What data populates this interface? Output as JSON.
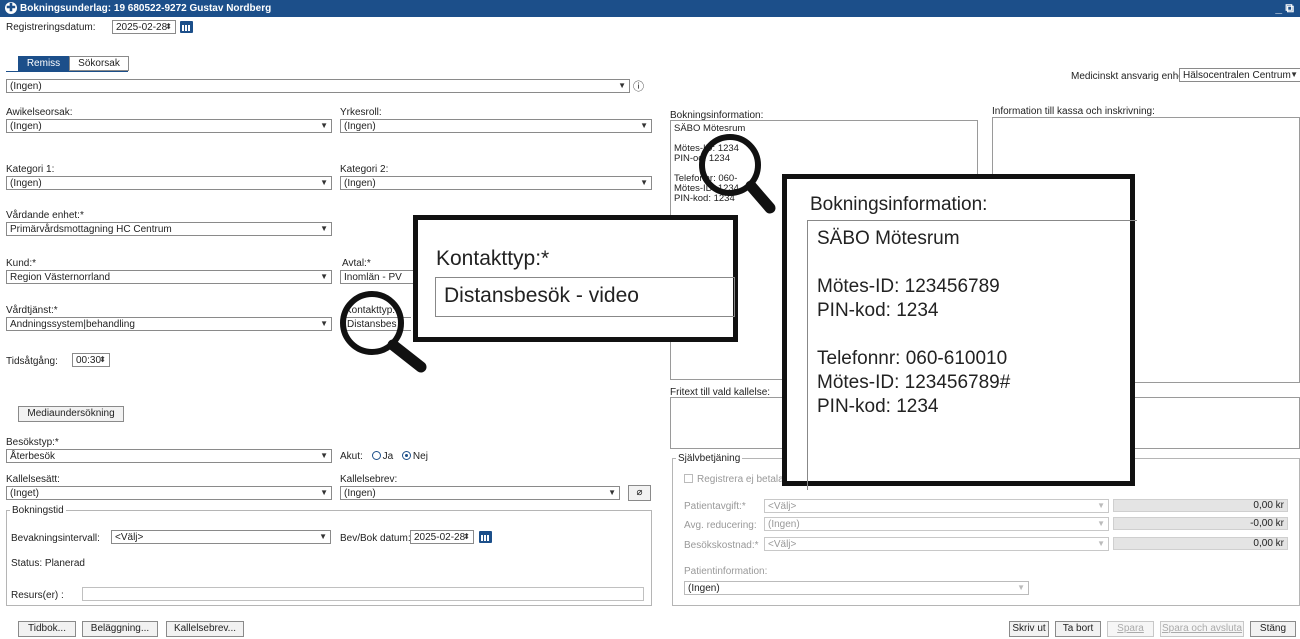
{
  "window": {
    "title": "Bokningsunderlag: 19 680522-9272 Gustav Nordberg",
    "controls": "_ ⧉"
  },
  "registrering": {
    "label": "Registreringsdatum:",
    "value": "2025-02-28"
  },
  "tabs": [
    {
      "label": "Remiss"
    },
    {
      "label": "Sökorsak"
    }
  ],
  "remiss_select": "(Ingen)",
  "medicinskt": {
    "label": "Medicinskt ansvarig enhet*:",
    "value": "Hälsocentralen Centrum"
  },
  "avvikelseorsak": {
    "label": "Awikelseorsak:",
    "value": "(Ingen)"
  },
  "yrkesroll": {
    "label": "Yrkesroll:",
    "value": "(Ingen)"
  },
  "kategori1": {
    "label": "Kategori 1:",
    "value": "(Ingen)"
  },
  "kategori2": {
    "label": "Kategori 2:",
    "value": "(Ingen)"
  },
  "vardande": {
    "label": "Vårdande enhet:*",
    "value": "Primärvårdsmottagning HC Centrum"
  },
  "kund": {
    "label": "Kund:*",
    "value": "Region Västernorrland"
  },
  "avtal": {
    "label": "Avtal:*",
    "value": "Inomlän - PV"
  },
  "vardtjanst": {
    "label": "Vårdtjänst:*",
    "value": "Andningssystem|behandling"
  },
  "kontakttyp": {
    "label": "Kontakttyp:*",
    "value": "Distansbesök - video",
    "small_value": "Distansbes"
  },
  "tidsatgang": {
    "label": "Tidsåtgång:",
    "value": "00:30"
  },
  "mediaundersokning": "Mediaundersökning",
  "besokstyp": {
    "label": "Besökstyp:*",
    "value": "Återbesök"
  },
  "akut": {
    "label": "Akut:",
    "ja": "Ja",
    "nej": "Nej"
  },
  "kallelsesatt": {
    "label": "Kallelsesätt:",
    "value": "(Inget)"
  },
  "kallelsebrev": {
    "label": "Kallelsebrev:",
    "value": "(Ingen)"
  },
  "bokningstid": {
    "legend": "Bokningstid",
    "bevakning_label": "Bevakningsintervall:",
    "bevakning_value": "<Välj>",
    "bevbok_label": "Bev/Bok datum:*",
    "bevbok_value": "2025-02-28",
    "status": "Status: Planerad",
    "resurs_label": "Resurs(er) :"
  },
  "bokningsinformation": {
    "label": "Bokningsinformation:",
    "lines": [
      "SÄBO Mötesrum",
      "",
      "Mötes-ID: 123456789",
      "PIN-kod: 1234",
      "",
      "Telefonnr: 060-610010",
      "Mötes-ID: 123456789#",
      "PIN-kod: 1234"
    ],
    "small_lines": [
      "SÄBO Mötesrum",
      "",
      "Möte",
      "PIN-",
      "",
      "Tele",
      "Möte",
      "PIN-kod: 1234"
    ]
  },
  "small_partial": [
    "s-ID: 1234",
    "od: 1234",
    "fonnr: 060-",
    "s-ID: 1234"
  ],
  "info_kassa": {
    "label": "Information till kassa och inskrivning:"
  },
  "fritext": {
    "label": "Fritext till vald kallelse:"
  },
  "sjalvbetjaning": {
    "legend": "Självbetjäning",
    "registrera": "Registrera ej betala",
    "patientavgift": {
      "label": "Patientavgift:*",
      "value": "<Välj>",
      "amount": "0,00 kr"
    },
    "avg_reducering": {
      "label": "Avg. reducering:",
      "value": "(Ingen)",
      "amount": "-0,00 kr"
    },
    "besokskostnad": {
      "label": "Besökskostnad:*",
      "value": "<Välj>",
      "amount": "0,00 kr"
    },
    "patientinformation": {
      "label": "Patientinformation:",
      "value": "(Ingen)"
    }
  },
  "buttons_left": [
    "Tidbok...",
    "Beläggning...",
    "Kallelsebrev..."
  ],
  "buttons_right": [
    "Skriv ut",
    "Ta bort",
    "Spara",
    "Spara och avsluta",
    "Stäng"
  ],
  "zoom_kontakt": {
    "label": "Kontakttyp:*",
    "value": "Distansbesök - video"
  },
  "zoom_boknings": {
    "label": "Bokningsinformation:"
  }
}
